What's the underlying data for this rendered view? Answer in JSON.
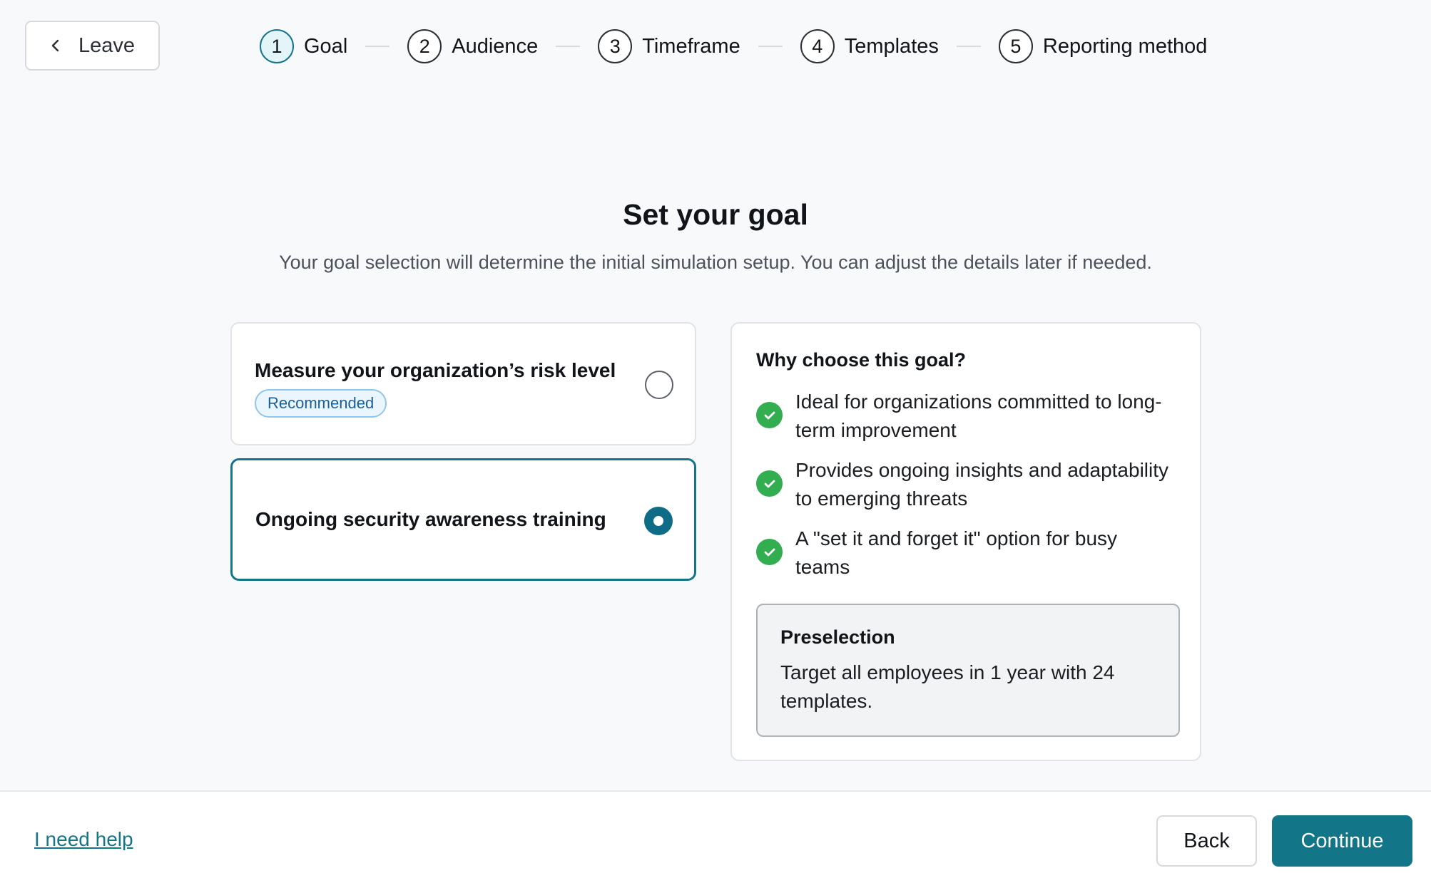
{
  "header": {
    "leave_label": "Leave",
    "steps": [
      {
        "number": "1",
        "label": "Goal",
        "state": "active"
      },
      {
        "number": "2",
        "label": "Audience",
        "state": "upcoming"
      },
      {
        "number": "3",
        "label": "Timeframe",
        "state": "upcoming"
      },
      {
        "number": "4",
        "label": "Templates",
        "state": "upcoming"
      },
      {
        "number": "5",
        "label": "Reporting method",
        "state": "upcoming"
      }
    ]
  },
  "main": {
    "title": "Set your goal",
    "subtitle": "Your goal selection will determine the initial simulation setup. You can adjust the details later if needed.",
    "options": [
      {
        "title": "Measure your organization’s risk level",
        "badge": "Recommended",
        "selected": false
      },
      {
        "title": "Ongoing security awareness training",
        "selected": true
      }
    ],
    "info": {
      "title": "Why choose this goal?",
      "benefits": [
        "Ideal for organizations committed to long-term improvement",
        "Provides ongoing insights and adaptability to emerging threats",
        "A \"set it and forget it\" option for busy teams"
      ],
      "preselection_title": "Preselection",
      "preselection_text": "Target all employees in 1 year with 24 templates."
    }
  },
  "footer": {
    "help_label": "I need help",
    "back_label": "Back",
    "continue_label": "Continue"
  },
  "colors": {
    "primary": "#137688",
    "success": "#32ad50",
    "badge_border": "#8fc6ec"
  },
  "icons": {
    "leave": "chevron-left-icon",
    "benefit": "check-circle-icon"
  }
}
